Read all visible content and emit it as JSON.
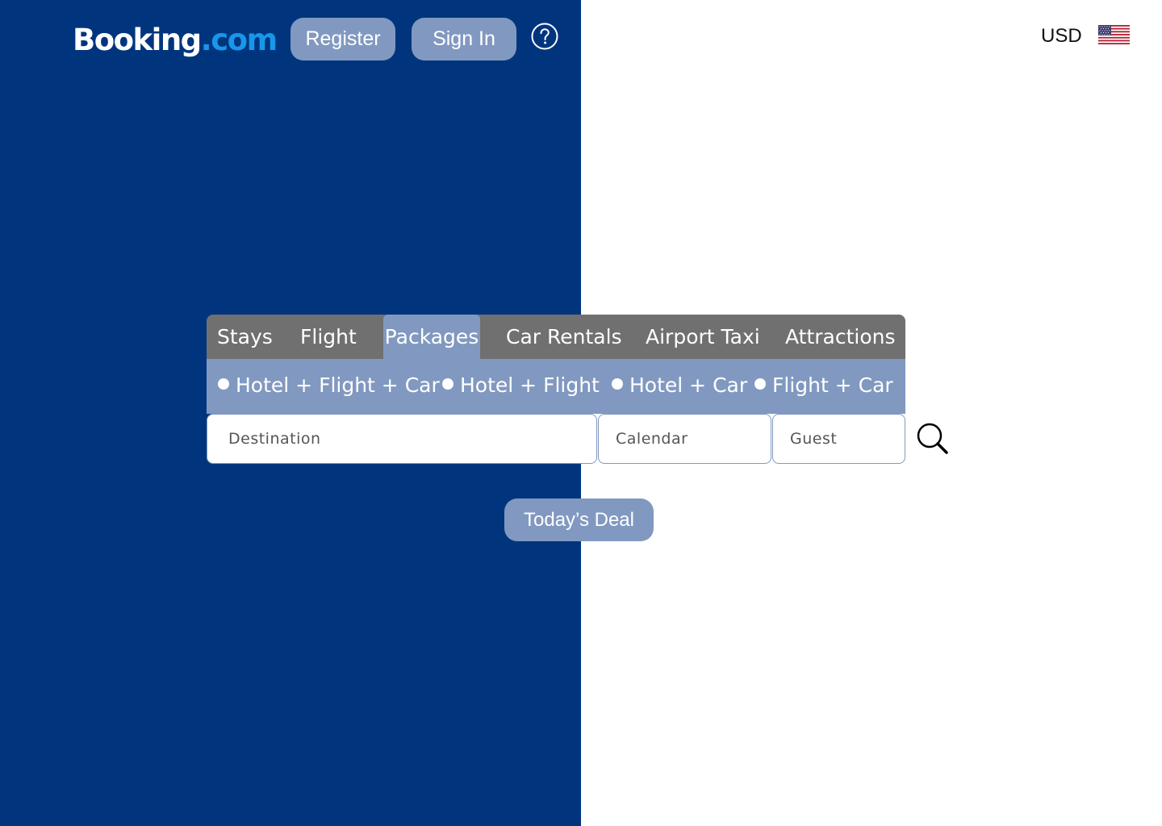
{
  "header": {
    "logo_main": "Booking",
    "logo_tld": ".com",
    "register_label": "Register",
    "signin_label": "Sign In",
    "help_icon": "question-circle-icon",
    "currency": "USD",
    "flag_icon": "us-flag-icon"
  },
  "search": {
    "tabs": [
      {
        "label": "Stays",
        "active": false
      },
      {
        "label": "Flight",
        "active": false
      },
      {
        "label": "Packages",
        "active": true
      },
      {
        "label": "Car Rentals",
        "active": false
      },
      {
        "label": "Airport Taxi",
        "active": false
      },
      {
        "label": "Attractions",
        "active": false
      }
    ],
    "package_options": [
      "Hotel + Flight + Car",
      "Hotel + Flight",
      "Hotel + Car",
      "Flight + Car"
    ],
    "destination_placeholder": "Destination",
    "calendar_placeholder": "Calendar",
    "guest_placeholder": "Guest",
    "search_icon": "search-icon"
  },
  "deal_label": "Today’s Deal",
  "colors": {
    "left_panel_bg": "#00357e",
    "button_bg": "#8199c0",
    "tab_bar_bg": "#707070",
    "logo_tld": "#1996ea"
  }
}
